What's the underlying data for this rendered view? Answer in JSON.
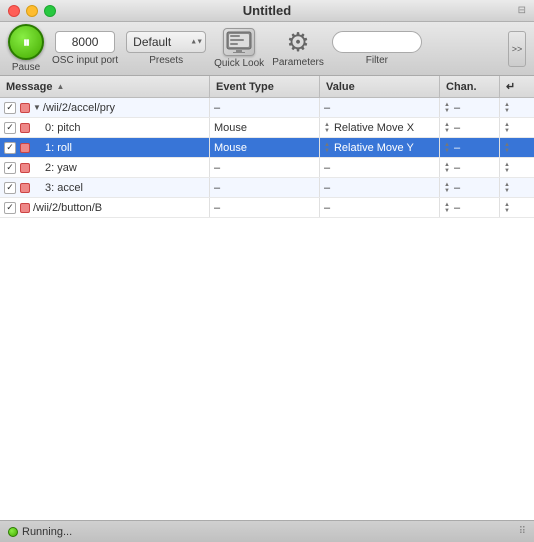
{
  "window": {
    "title": "Untitled",
    "controls": {
      "close": "close",
      "minimize": "minimize",
      "maximize": "maximize"
    }
  },
  "toolbar": {
    "pause_label": "Pause",
    "osc_port_value": "8000",
    "osc_port_label": "OSC input port",
    "preset_value": "Default",
    "preset_label": "Presets",
    "quick_look_label": "Quick Look",
    "quick_look_icon_text": "QL",
    "parameters_label": "Parameters",
    "filter_label": "Filter",
    "search_placeholder": "",
    "overflow_label": ">>"
  },
  "table": {
    "headers": [
      {
        "id": "message",
        "label": "Message"
      },
      {
        "id": "event-type",
        "label": "Event Type"
      },
      {
        "id": "value",
        "label": "Value"
      },
      {
        "id": "chan",
        "label": "Chan."
      },
      {
        "id": "end",
        "label": "↵"
      }
    ],
    "rows": [
      {
        "id": "row-wii-accel-pry",
        "indent": 1,
        "checked": true,
        "hasTriangle": true,
        "message": "/wii/2/accel/pry",
        "event_type": "–",
        "value": "–",
        "chan": "–",
        "selected": false,
        "even": true
      },
      {
        "id": "row-pitch",
        "indent": 2,
        "checked": true,
        "hasTriangle": false,
        "message": "0: pitch",
        "event_type": "Mouse",
        "value": "Relative Move X",
        "chan": "–",
        "selected": false,
        "even": false
      },
      {
        "id": "row-roll",
        "indent": 2,
        "checked": true,
        "hasTriangle": false,
        "message": "1: roll",
        "event_type": "Mouse",
        "value": "Relative Move Y",
        "chan": "–",
        "selected": true,
        "even": true
      },
      {
        "id": "row-yaw",
        "indent": 2,
        "checked": true,
        "hasTriangle": false,
        "message": "2: yaw",
        "event_type": "–",
        "value": "–",
        "chan": "–",
        "selected": false,
        "even": false
      },
      {
        "id": "row-accel",
        "indent": 2,
        "checked": true,
        "hasTriangle": false,
        "message": "3: accel",
        "event_type": "–",
        "value": "–",
        "chan": "–",
        "selected": false,
        "even": true
      },
      {
        "id": "row-wii-button",
        "indent": 1,
        "checked": true,
        "hasTriangle": false,
        "message": "/wii/2/button/B",
        "event_type": "–",
        "value": "–",
        "chan": "–",
        "selected": false,
        "even": false
      }
    ]
  },
  "status": {
    "text": "Running...",
    "state": "running"
  }
}
